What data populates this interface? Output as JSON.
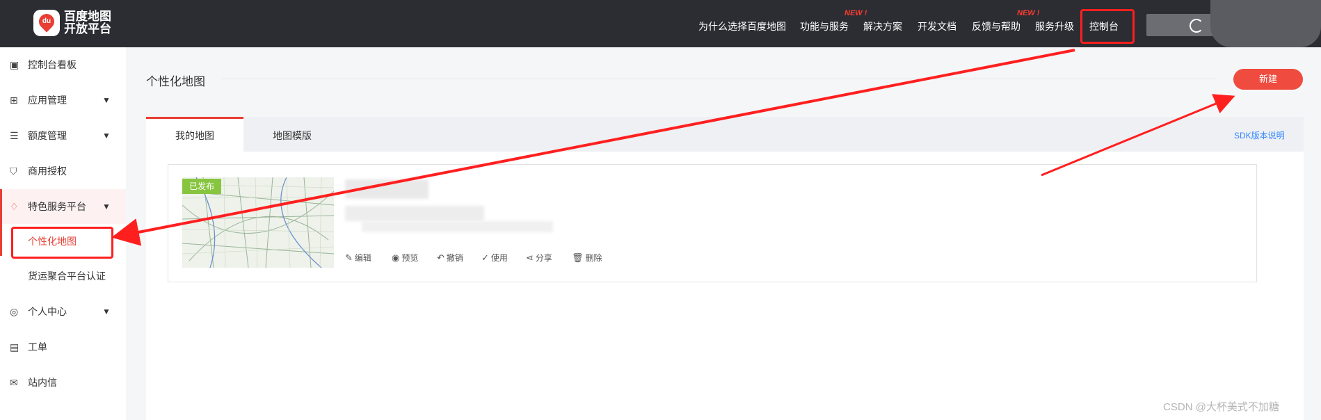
{
  "brand": {
    "logo_mark": "du",
    "line1": "百度地图",
    "line2": "开放平台"
  },
  "nav": {
    "items": [
      {
        "label": "为什么选择百度地图",
        "badge": ""
      },
      {
        "label": "功能与服务",
        "badge": "NEW !"
      },
      {
        "label": "解决方案",
        "badge": ""
      },
      {
        "label": "开发文档",
        "badge": ""
      },
      {
        "label": "反馈与帮助",
        "badge": "NEW !"
      },
      {
        "label": "服务升级",
        "badge": ""
      },
      {
        "label": "控制台",
        "badge": ""
      }
    ]
  },
  "sidebar": {
    "items": [
      {
        "label": "控制台看板",
        "icon": "dashboard-icon"
      },
      {
        "label": "应用管理",
        "icon": "grid-icon",
        "caret": "▼"
      },
      {
        "label": "额度管理",
        "icon": "sliders-icon",
        "caret": "▼"
      },
      {
        "label": "商用授权",
        "icon": "shield-check-icon"
      },
      {
        "label": "特色服务平台",
        "icon": "diamond-icon",
        "caret": "▼"
      },
      {
        "label": "个性化地图",
        "icon": ""
      },
      {
        "label": "货运聚合平台认证",
        "icon": ""
      },
      {
        "label": "个人中心",
        "icon": "user-circle-icon",
        "caret": "▼"
      },
      {
        "label": "工单",
        "icon": "clipboard-icon"
      },
      {
        "label": "站内信",
        "icon": "mail-icon"
      }
    ]
  },
  "main": {
    "title": "个性化地图",
    "new_button": "新建",
    "tabs": [
      {
        "label": "我的地图"
      },
      {
        "label": "地图模版"
      }
    ],
    "sdk_link": "SDK版本说明",
    "card": {
      "status": "已发布",
      "actions": [
        {
          "label": "编辑",
          "icon": "edit-icon"
        },
        {
          "label": "预览",
          "icon": "eye-icon"
        },
        {
          "label": "撤销",
          "icon": "undo-icon"
        },
        {
          "label": "使用",
          "icon": "check-circle-icon"
        },
        {
          "label": "分享",
          "icon": "share-icon"
        },
        {
          "label": "删除",
          "icon": "trash-icon"
        }
      ]
    }
  },
  "watermark": "CSDN @大杯美式不加糖",
  "colors": {
    "accent": "#e83e34",
    "annotation": "#ff1f1f",
    "topbar": "#2b2d33",
    "badge": "#87c540"
  }
}
